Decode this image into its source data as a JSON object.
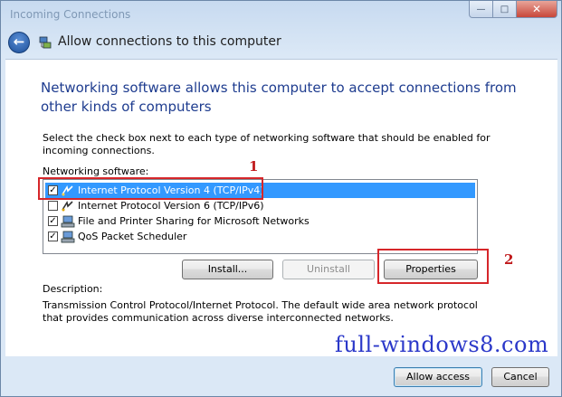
{
  "window": {
    "title": "Incoming Connections",
    "caption": {
      "minimize": "—",
      "maximize": "□",
      "close": "✕"
    }
  },
  "nav": {
    "back_glyph": "←",
    "title": "Allow connections to this computer",
    "icon": "network-connection-icon"
  },
  "heading": "Networking software allows this computer to accept connections from other kinds of computers",
  "instruction": "Select the check box next to each type of networking software that should be enabled for incoming connections.",
  "networking_label": "Networking software:",
  "items": [
    {
      "label": "Internet Protocol Version 4 (TCP/IPv4)",
      "checked": true,
      "selected": true,
      "icon": "protocol-icon"
    },
    {
      "label": "Internet Protocol Version 6 (TCP/IPv6)",
      "checked": false,
      "selected": false,
      "icon": "protocol-icon"
    },
    {
      "label": "File and Printer Sharing for Microsoft Networks",
      "checked": true,
      "selected": false,
      "icon": "service-icon"
    },
    {
      "label": "QoS Packet Scheduler",
      "checked": true,
      "selected": false,
      "icon": "service-icon"
    }
  ],
  "buttons": {
    "install": "Install...",
    "uninstall": "Uninstall",
    "properties": "Properties",
    "allow_access": "Allow access",
    "cancel": "Cancel"
  },
  "description_label": "Description:",
  "description_text": "Transmission Control Protocol/Internet Protocol. The default wide area network protocol that provides communication across diverse interconnected networks.",
  "annotations": {
    "marker1": "1",
    "marker2": "2",
    "highlight_color": "#d6262a"
  },
  "watermark": "full-windows8.com",
  "colors": {
    "heading": "#1e3c8f",
    "selection": "#3399ff",
    "watermark": "#2b38c9"
  }
}
